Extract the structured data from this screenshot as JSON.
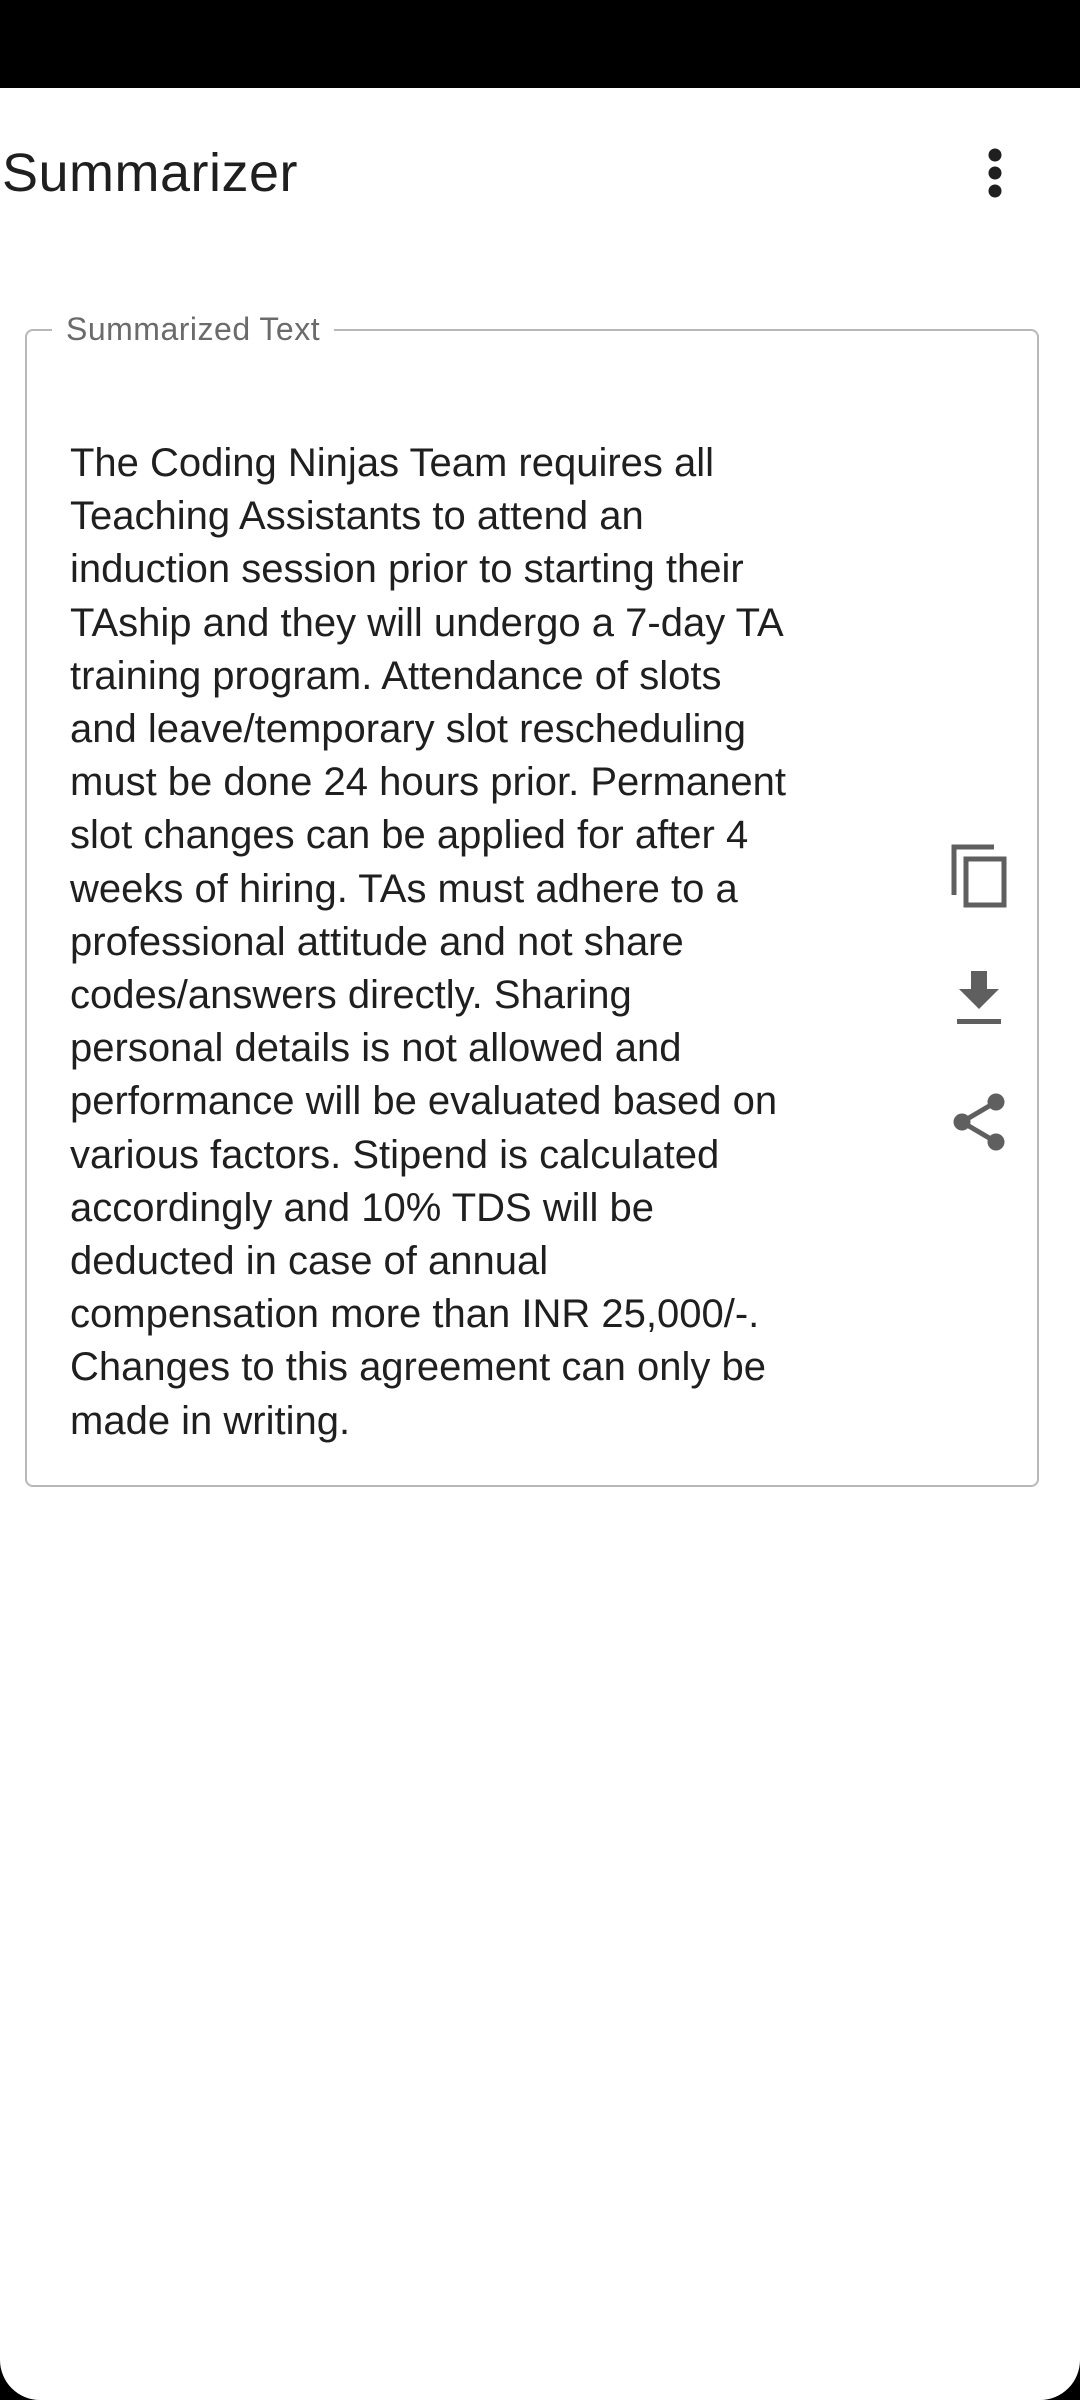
{
  "app_bar": {
    "title": "Summarizer",
    "menu_icon": "more-vert-icon"
  },
  "summary_card": {
    "label": "Summarized Text",
    "text": "The Coding Ninjas Team requires all\nTeaching Assistants to attend an\ninduction session prior to starting their\nTAship and they will undergo a 7-day TA\ntraining program. Attendance of slots\nand leave/temporary slot rescheduling\nmust be done 24 hours prior. Permanent\nslot changes can be applied for after 4\nweeks of hiring. TAs must adhere to a\nprofessional attitude and not share\ncodes/answers directly. Sharing\npersonal details is not allowed and\nperformance will be evaluated based on\nvarious factors. Stipend is calculated\naccordingly and 10% TDS will be\ndeducted in case of annual\ncompensation more than INR 25,000/-.\nChanges to this agreement can only be\nmade in writing.",
    "actions": [
      {
        "icon": "copy-icon"
      },
      {
        "icon": "download-icon"
      },
      {
        "icon": "share-icon"
      }
    ]
  },
  "colors": {
    "text": "#1f1f1f",
    "label": "#6b6b6b",
    "icon": "#5f5f5f",
    "outline": "#b8b8b8",
    "status_bar": "#000000",
    "background": "#ffffff"
  }
}
